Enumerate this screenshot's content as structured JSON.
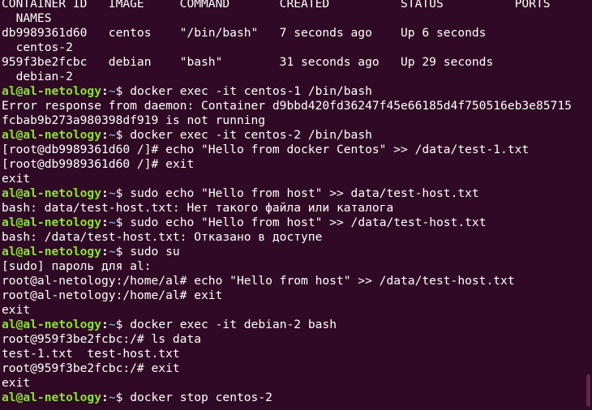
{
  "colors": {
    "background": "#300a24",
    "text": "#ffffff",
    "prompt_user": "#8ae234",
    "prompt_path": "#729fcf"
  },
  "terminal": {
    "lines": [
      {
        "type": "text",
        "text": "CONTAINER ID   IMAGE     COMMAND       CREATED          STATUS          PORTS"
      },
      {
        "type": "text",
        "text": "  NAMES"
      },
      {
        "type": "text",
        "text": "db9989361d60   centos    \"/bin/bash\"   7 seconds ago    Up 6 seconds"
      },
      {
        "type": "text",
        "text": "  centos-2"
      },
      {
        "type": "text",
        "text": "959f3be2fcbc   debian    \"bash\"        31 seconds ago   Up 29 seconds"
      },
      {
        "type": "text",
        "text": "  debian-2"
      },
      {
        "type": "prompt",
        "user": "al@al-netology",
        "sep": ":",
        "path": "~",
        "symbol": "$ ",
        "cmd": "docker exec -it centos-1 /bin/bash"
      },
      {
        "type": "text",
        "text": "Error response from daemon: Container d9bbd420fd36247f45e66185d4f750516eb3e85715"
      },
      {
        "type": "text",
        "text": "fcbab9b273a980398df919 is not running"
      },
      {
        "type": "prompt",
        "user": "al@al-netology",
        "sep": ":",
        "path": "~",
        "symbol": "$ ",
        "cmd": "docker exec -it centos-2 /bin/bash"
      },
      {
        "type": "text",
        "text": "[root@db9989361d60 /]# echo \"Hello from docker Centos\" >> /data/test-1.txt"
      },
      {
        "type": "text",
        "text": "[root@db9989361d60 /]# exit"
      },
      {
        "type": "text",
        "text": "exit"
      },
      {
        "type": "prompt",
        "user": "al@al-netology",
        "sep": ":",
        "path": "~",
        "symbol": "$ ",
        "cmd": "sudo echo \"Hello from host\" >> data/test-host.txt"
      },
      {
        "type": "text",
        "text": "bash: data/test-host.txt: Нет такого файла или каталога"
      },
      {
        "type": "prompt",
        "user": "al@al-netology",
        "sep": ":",
        "path": "~",
        "symbol": "$ ",
        "cmd": "sudo echo \"Hello from host\" >> /data/test-host.txt"
      },
      {
        "type": "text",
        "text": "bash: /data/test-host.txt: Отказано в доступе"
      },
      {
        "type": "prompt",
        "user": "al@al-netology",
        "sep": ":",
        "path": "~",
        "symbol": "$ ",
        "cmd": "sudo su"
      },
      {
        "type": "text",
        "text": "[sudo] пароль для al:"
      },
      {
        "type": "text",
        "text": "root@al-netology:/home/al# echo \"Hello from host\" >> /data/test-host.txt"
      },
      {
        "type": "text",
        "text": "root@al-netology:/home/al# exit"
      },
      {
        "type": "text",
        "text": "exit"
      },
      {
        "type": "prompt",
        "user": "al@al-netology",
        "sep": ":",
        "path": "~",
        "symbol": "$ ",
        "cmd": "docker exec -it debian-2 bash"
      },
      {
        "type": "text",
        "text": "root@959f3be2fcbc:/# ls data"
      },
      {
        "type": "text",
        "text": "test-1.txt  test-host.txt"
      },
      {
        "type": "text",
        "text": "root@959f3be2fcbc:/# exit"
      },
      {
        "type": "text",
        "text": "exit"
      },
      {
        "type": "prompt",
        "user": "al@al-netology",
        "sep": ":",
        "path": "~",
        "symbol": "$ ",
        "cmd": "docker stop centos-2"
      }
    ]
  }
}
